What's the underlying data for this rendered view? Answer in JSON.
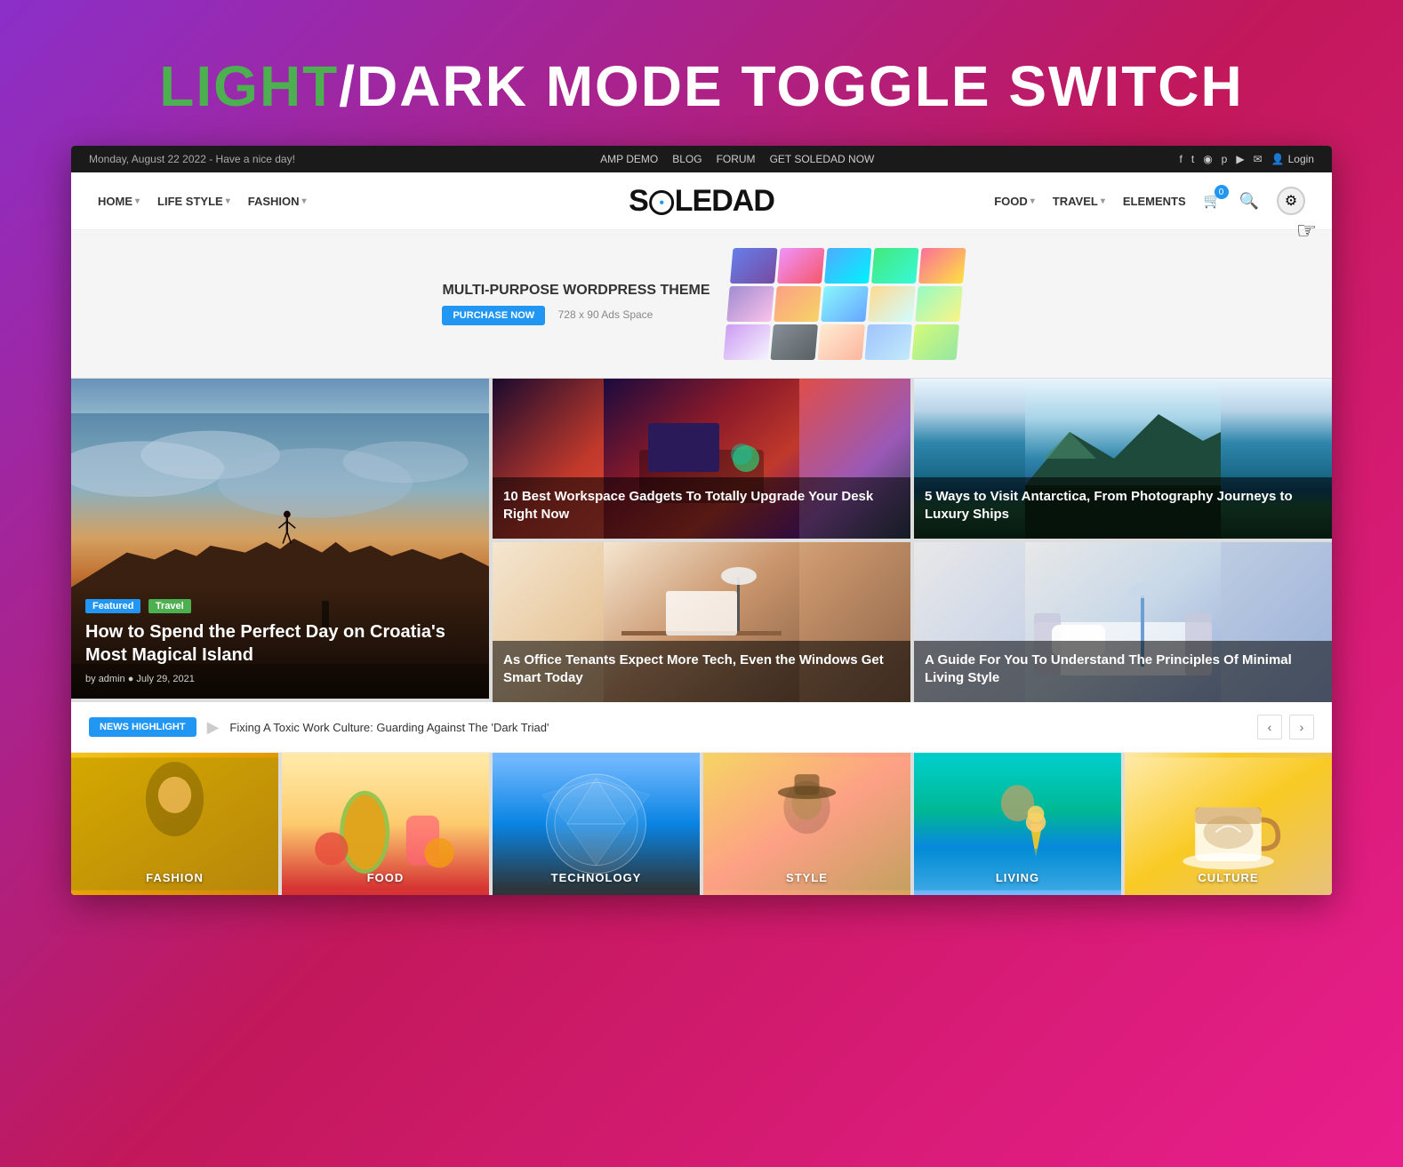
{
  "page": {
    "title_light": "LIGHT",
    "title_separator": "/",
    "title_dark": "DARK MODE TOGGLE SWITCH"
  },
  "topbar": {
    "date_text": "Monday, August 22 2022 - Have a nice day!",
    "nav": {
      "amp_demo": "AMP DEMO",
      "blog": "BLOG",
      "forum": "FORUM",
      "get_soledad": "GET SOLEDAD NOW"
    },
    "login": "Login"
  },
  "mainnav": {
    "left": [
      {
        "label": "HOME",
        "has_dropdown": true
      },
      {
        "label": "LIFE STYLE",
        "has_dropdown": true
      },
      {
        "label": "FASHION",
        "has_dropdown": true
      }
    ],
    "logo": "SOLEDAD",
    "right": [
      {
        "label": "FOOD",
        "has_dropdown": true
      },
      {
        "label": "TRAVEL",
        "has_dropdown": true
      },
      {
        "label": "ELEMENTS",
        "has_dropdown": false
      }
    ],
    "cart_count": "0"
  },
  "ad_banner": {
    "title": "MULTI-PURPOSE WORDPRESS THEME",
    "button": "PURCHASE NOW",
    "size_text": "728 x 90 Ads Space"
  },
  "articles": {
    "main": {
      "tags": [
        "Featured",
        "Travel"
      ],
      "title": "How to Spend the Perfect Day on Croatia's Most Magical Island",
      "author": "admin",
      "date": "July 29, 2021"
    },
    "top_mid": {
      "title": "10 Best Workspace Gadgets To Totally Upgrade Your Desk Right Now"
    },
    "top_right": {
      "title": "5 Ways to Visit Antarctica, From Photography Journeys to Luxury Ships"
    },
    "bottom_mid": {
      "title": "As Office Tenants Expect More Tech, Even the Windows Get Smart Today"
    },
    "bottom_right": {
      "title": "A Guide For You To Understand The Principles Of Minimal Living Style"
    }
  },
  "news_highlight": {
    "badge": "NEWS HIGHLIGHT",
    "text": "Fixing A Toxic Work Culture: Guarding Against The 'Dark Triad'"
  },
  "categories": [
    {
      "label": "FASHION",
      "class": "cat-fashion"
    },
    {
      "label": "FOOD",
      "class": "cat-food"
    },
    {
      "label": "TECHNOLOGY",
      "class": "cat-technology"
    },
    {
      "label": "STYLE",
      "class": "cat-style"
    },
    {
      "label": "LIVING",
      "class": "cat-living"
    },
    {
      "label": "CULTURE",
      "class": "cat-culture"
    }
  ],
  "icons": {
    "cart": "🛒",
    "search": "🔍",
    "theme_toggle": "⚙",
    "hand_cursor": "☞",
    "login_icon": "👤",
    "chevron_down": "▾",
    "arrow_left": "‹",
    "arrow_right": "›",
    "news_arrow": "▶"
  }
}
